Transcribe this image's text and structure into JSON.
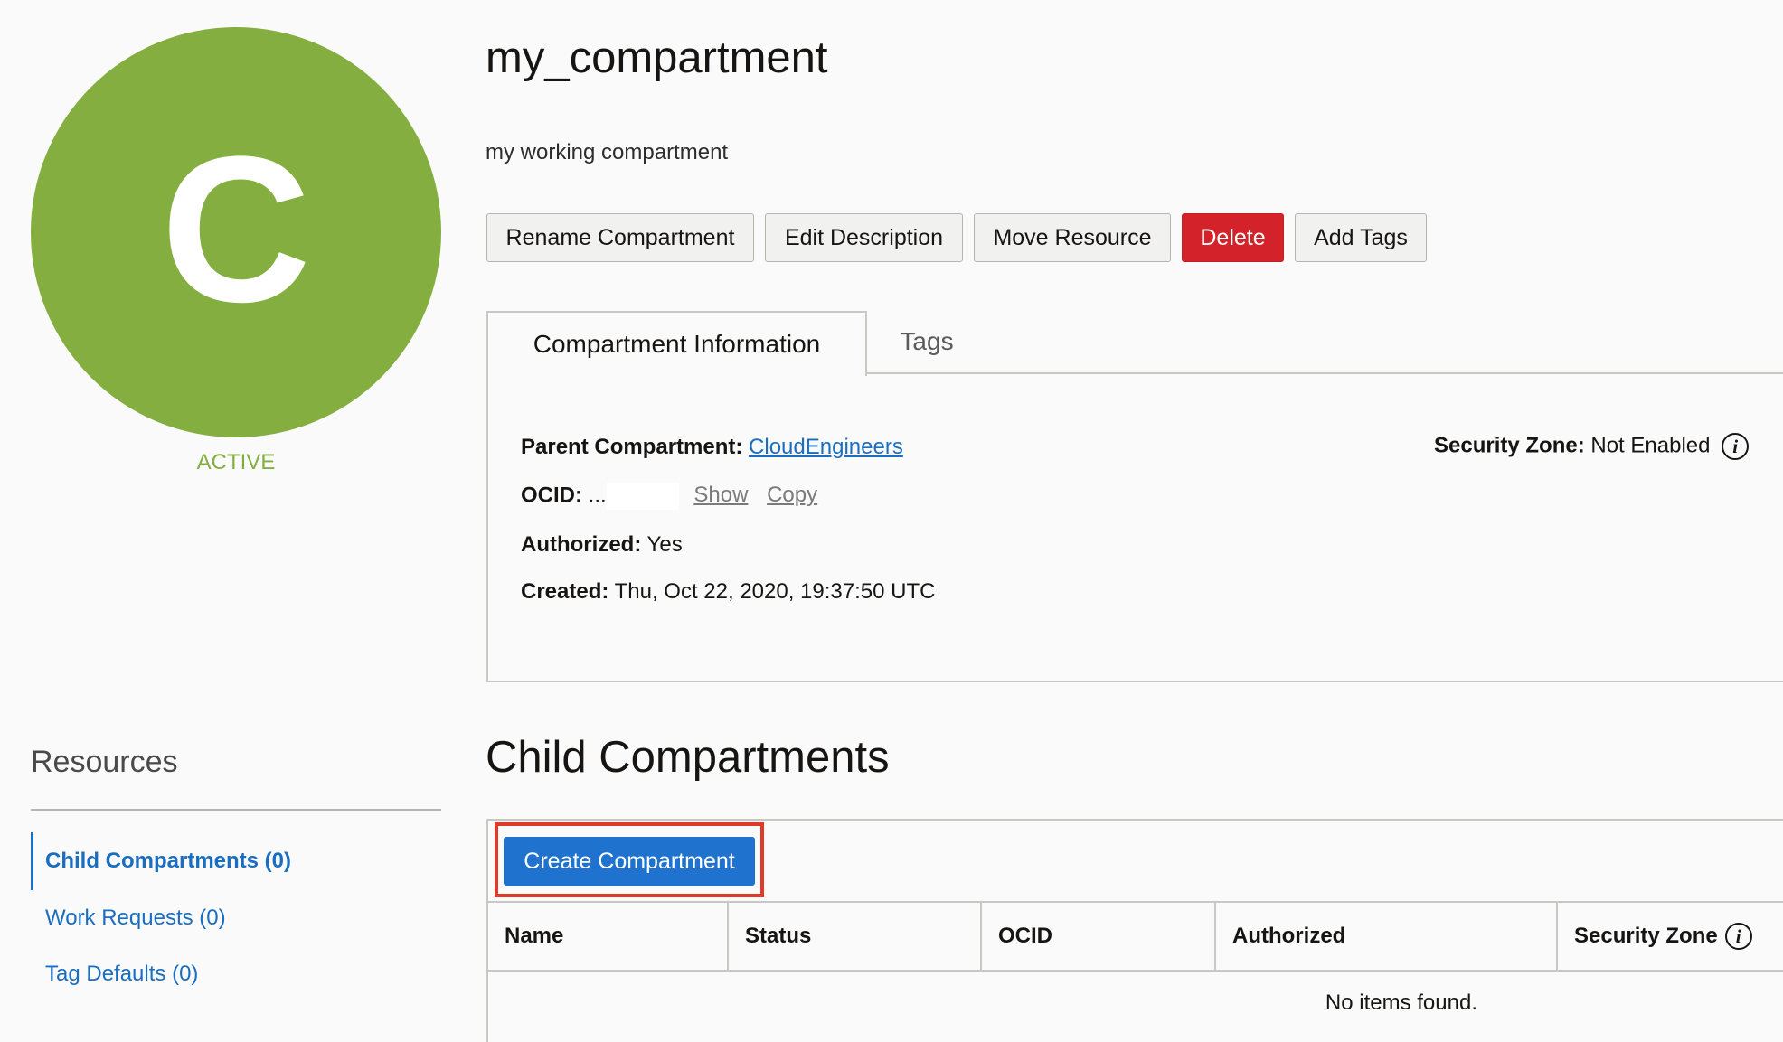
{
  "compartment": {
    "avatar_letter": "C",
    "status": "ACTIVE",
    "name": "my_compartment",
    "description": "my working compartment"
  },
  "actions": {
    "rename": "Rename Compartment",
    "edit_description": "Edit Description",
    "move_resource": "Move Resource",
    "delete": "Delete",
    "add_tags": "Add Tags"
  },
  "tabs": {
    "info": "Compartment Information",
    "tags": "Tags"
  },
  "info": {
    "parent_label": "Parent Compartment:",
    "parent_value": "CloudEngineers",
    "ocid_label": "OCID:",
    "ocid_value": "...",
    "show": "Show",
    "copy": "Copy",
    "authorized_label": "Authorized:",
    "authorized_value": "Yes",
    "created_label": "Created:",
    "created_value": "Thu, Oct 22, 2020, 19:37:50 UTC",
    "security_zone_label": "Security Zone:",
    "security_zone_value": "Not Enabled",
    "info_glyph": "i"
  },
  "resources": {
    "title": "Resources",
    "items": [
      {
        "label": "Child Compartments (0)",
        "active": true
      },
      {
        "label": "Work Requests (0)",
        "active": false
      },
      {
        "label": "Tag Defaults (0)",
        "active": false
      }
    ]
  },
  "child_compartments": {
    "title": "Child Compartments",
    "create_button": "Create Compartment",
    "columns": [
      "Name",
      "Status",
      "OCID",
      "Authorized",
      "Security Zone"
    ],
    "empty_message": "No items found."
  },
  "colors": {
    "avatar": "#84ae3f",
    "link": "#1a6ec1",
    "danger": "#d3222a",
    "primary": "#1f73cf",
    "highlight": "#e03b2a"
  }
}
